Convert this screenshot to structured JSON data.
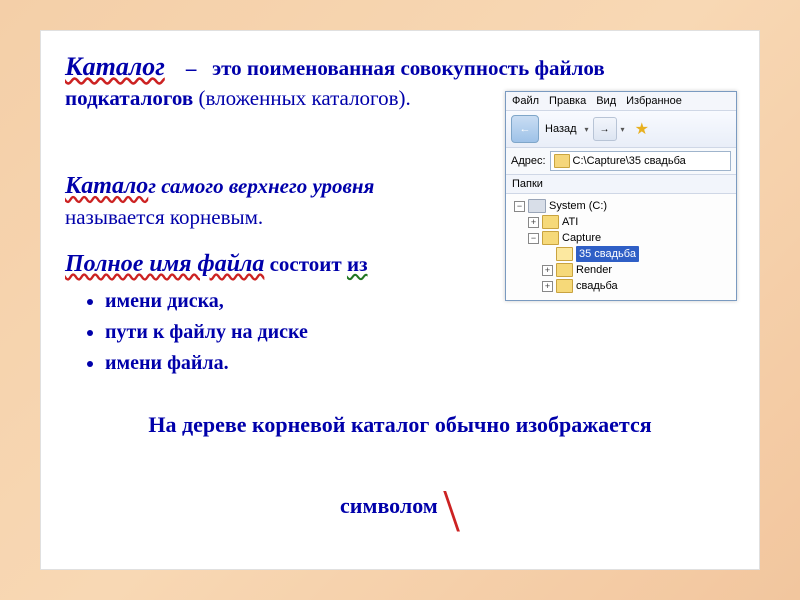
{
  "definition": {
    "term": "Каталог",
    "dash": "–",
    "rest_bold": "это поименованная совокупность файлов",
    "line2_bold": "подкаталогов",
    "line2_rest": " (вложенных каталогов)."
  },
  "sect2": {
    "term_start": "Катало",
    "term_end": "г самого верхнего уровня",
    "line2": " называется корневым."
  },
  "sect3": {
    "term": "Полное имя файла",
    "consists": " состоит ",
    "uz": "из",
    "bullets": [
      "имени диска,",
      "пути к файлу на диске",
      "имени файла."
    ]
  },
  "bottom": {
    "line1": "На дереве корневой каталог обычно изображается",
    "line2_pre": "символом ",
    "slash": "\\"
  },
  "explorer": {
    "menu": {
      "file": "Файл",
      "edit": "Правка",
      "view": "Вид",
      "fav": "Избранное"
    },
    "back": {
      "glyph": "←",
      "label": "Назад",
      "caret": "▾"
    },
    "fwd_glyph": "→",
    "search_glyph": "★",
    "addr_label": "Адрес:",
    "addr_path": "C:\\Capture\\35 свадьба",
    "panes_label": "Папки",
    "tree": {
      "root": {
        "pm": "−",
        "label": "System (C:)"
      },
      "ati": {
        "pm": "+",
        "label": "ATI"
      },
      "capture": {
        "pm": "−",
        "label": "Capture"
      },
      "sel": {
        "label": "35 свадьба"
      },
      "render": {
        "pm": "+",
        "label": "Render"
      },
      "svadba": {
        "pm": "+",
        "label": "свадьба"
      }
    }
  }
}
